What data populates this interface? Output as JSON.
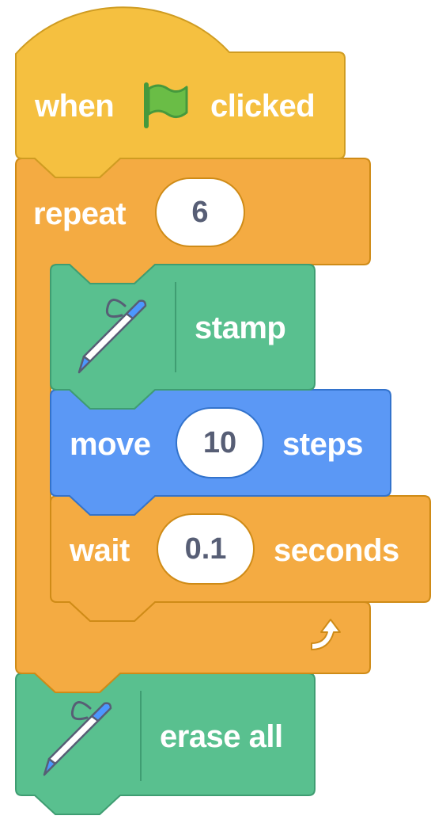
{
  "script": {
    "hat_block": {
      "label_before": "when",
      "icon": "green-flag-icon",
      "label_after": "clicked",
      "color": "#FFBF00"
    },
    "repeat_block": {
      "label": "repeat",
      "count": "6",
      "icon": "loop-arrow-icon",
      "color": "#FFAB19"
    },
    "stamp_block": {
      "label": "stamp",
      "icon": "pen-icon",
      "color": "#0FBD8C"
    },
    "move_block": {
      "label_before": "move",
      "steps": "10",
      "label_after": "steps",
      "color": "#4C97FF"
    },
    "wait_block": {
      "label_before": "wait",
      "duration": "0.1",
      "label_after": "seconds",
      "color": "#FFAB19"
    },
    "erase_block": {
      "label": "erase all",
      "icon": "pen-icon",
      "color": "#0FBD8C"
    }
  }
}
